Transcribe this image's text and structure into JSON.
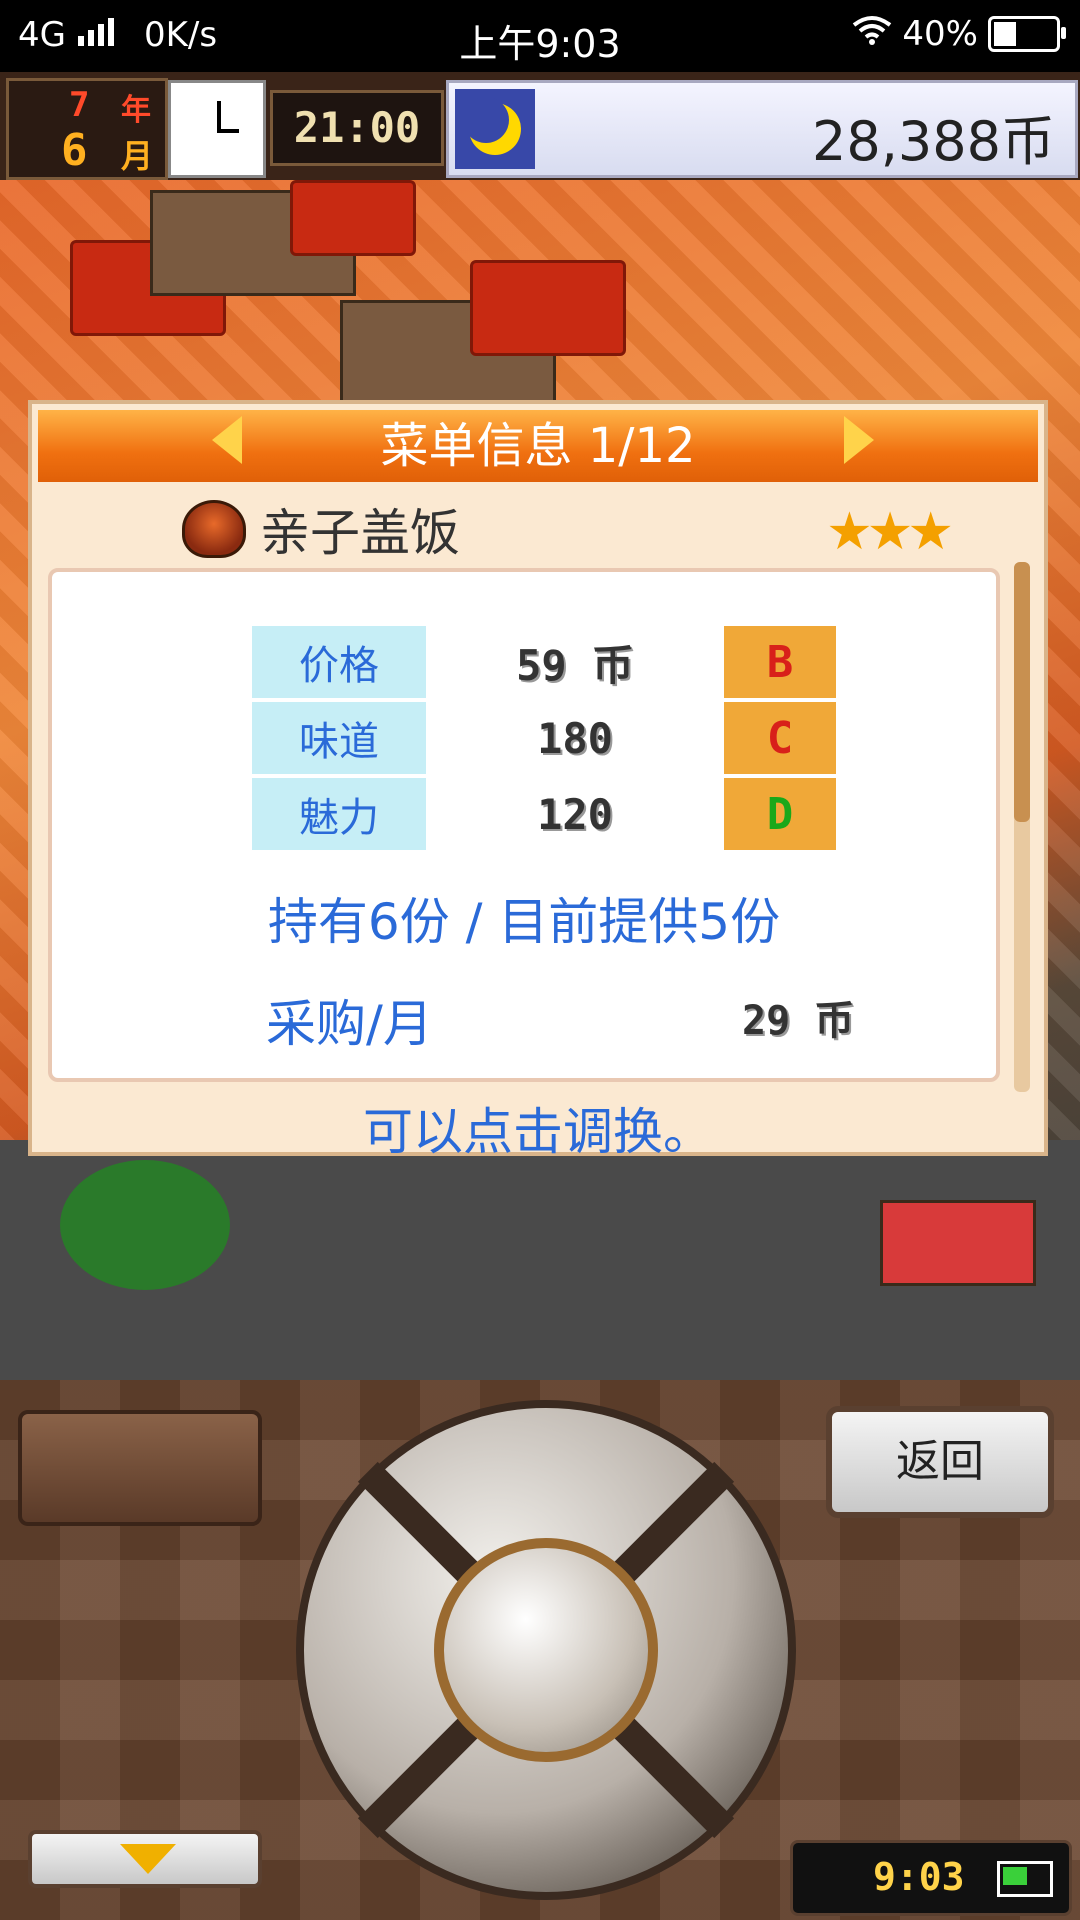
{
  "status_bar": {
    "network": "4G",
    "speed": "0K/s",
    "time": "上午9:03",
    "battery": "40%",
    "battery_level": 0.4
  },
  "hud": {
    "year_value": "7",
    "year_label": "年",
    "month_value": "6",
    "month_label": "月",
    "time": "21:00",
    "money": "28,388币",
    "icons": [
      "clock-icon",
      "moon-icon"
    ]
  },
  "dialog": {
    "title": "菜单信息 1/12",
    "dish_name": "亲子盖饭",
    "stars": "★★★",
    "rating": 3,
    "stats": [
      {
        "label": "价格",
        "value": "59 币",
        "grade": "B",
        "grade_color": "#d8201a"
      },
      {
        "label": "味道",
        "value": "180",
        "grade": "C",
        "grade_color": "#d8201a"
      },
      {
        "label": "魅力",
        "value": "120",
        "grade": "D",
        "grade_color": "#1aa81a"
      }
    ],
    "stock_text": "持有6份 / 目前提供5份",
    "purchase_label": "采购/月",
    "purchase_value": "29 币",
    "hint": "可以点击调换。"
  },
  "controller": {
    "back_label": "返回",
    "clock": "9:03"
  },
  "colors": {
    "header_orange": "#f07010",
    "label_blue": "#2a6ad8",
    "label_bg": "#c6eef6",
    "grade_bg": "#f0a838"
  }
}
